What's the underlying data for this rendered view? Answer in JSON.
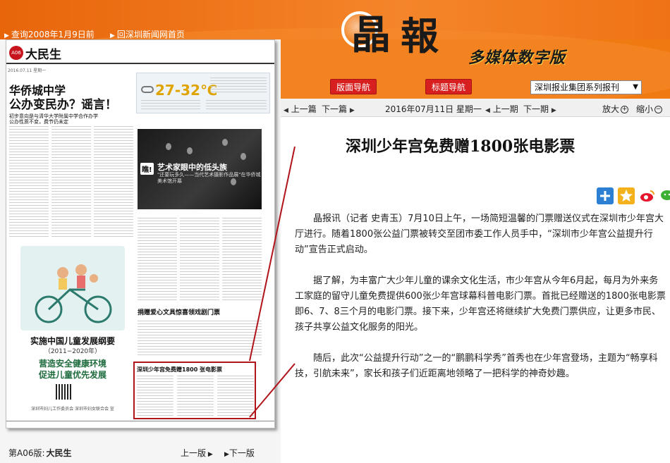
{
  "header": {
    "top_links": [
      "查询2008年1月9日前",
      "回深圳新闻网首页"
    ],
    "logo_chars": [
      "晶",
      "報"
    ],
    "subtitle": "多媒体数字版",
    "nav_buttons": [
      "版面导航",
      "标题导航"
    ],
    "newspaper_select": "深圳报业集团系列报刊"
  },
  "newspaper_page": {
    "section_badge": "A06",
    "section_name": "大民生",
    "date_line": "2016.07.11 星期一",
    "headline_1": "华侨城中学",
    "headline_2": "公办变民办？谣言！",
    "subhead": "初步意向是与清华大学附属中学合作办学\n公办性质不变，费节仍未定",
    "weather_temp": "27-32℃",
    "photo_caption": "艺术家眼中的低头族",
    "photo_sub": "\"还要玩多久——当代艺术摄影作品展\"在华侨城美术馆开幕",
    "photo_tag": "瞧!",
    "mid_headline": "捐赠爱心文具惊喜领戏剧门票",
    "ad_title": "实施中国儿童发展纲要",
    "ad_years": "（2011−2020年）",
    "ad_slogan_1": "营造安全健康环境",
    "ad_slogan_2": "促进儿童优先发展",
    "ad_footer": "深圳市妇儿工作委员会  深圳市妇女联合会 宣",
    "highlight_title": "深圳少年宫免费赠1800 张电影票",
    "page_label_prefix": "第A06版:",
    "page_label_name": "大民生",
    "prev_page": "上一版",
    "next_page": "下一版"
  },
  "article_nav": {
    "prev_article": "上一篇",
    "next_article": "下一篇",
    "date": "2016年07月11日 星期一",
    "prev_issue": "上一期",
    "next_issue": "下一期",
    "zoom_in": "放大",
    "zoom_out": "缩小"
  },
  "article": {
    "title": "深圳少年宫免费赠1800张电影票",
    "paragraphs": [
      "晶报讯（记者 史青玉）7月10日上午，一场简短温馨的门票赠送仪式在深圳市少年宫大厅进行。随着1800张公益门票被转交至团市委工作人员手中，“深圳市少年宫公益提升行动”宣告正式启动。",
      "据了解，为丰富广大少年儿童的课余文化生活，市少年宫从今年6月起，每月为外来务工家庭的留守儿童免费提供600张少年宫球幕科普电影门票。首批已经赠送的1800张电影票即6、7、8三个月的电影门票。接下来，少年宫还将继续扩大免费门票供应，让更多市民、孩子共享公益文化服务的阳光。",
      "随后，此次“公益提升行动”之一的“鹏鹏科学秀”首秀也在少年宫登场，主题为“畅享科技，引航未来”，家长和孩子们近距离地领略了一把科学的神奇妙趣。"
    ]
  },
  "colors": {
    "header_orange": "#f07a12",
    "nav_button_red": "#d81f1f",
    "highlight_border": "#b0141a"
  },
  "icons": [
    "plus-share-icon",
    "star-share-icon",
    "weibo-share-icon",
    "wechat-share-icon",
    "cloud-icon"
  ]
}
